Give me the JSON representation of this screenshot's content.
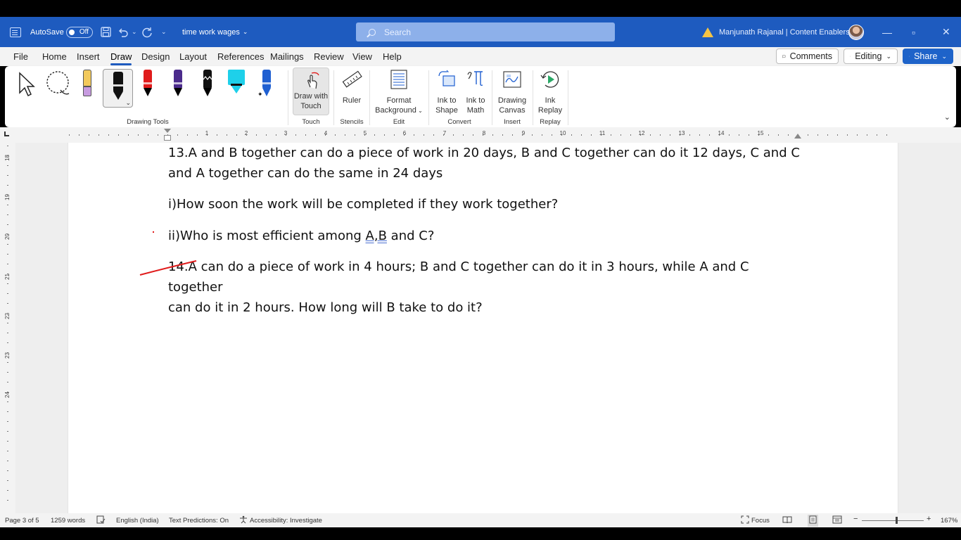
{
  "titlebar": {
    "autosave_label": "AutoSave",
    "autosave_state": "Off",
    "doc_title": "time work wages",
    "search_placeholder": "Search",
    "user_name": "Manjunath Rajanal | Content Enablers"
  },
  "menu": {
    "tabs": [
      "File",
      "Home",
      "Insert",
      "Draw",
      "Design",
      "Layout",
      "References",
      "Mailings",
      "Review",
      "View",
      "Help"
    ],
    "active_tab": "Draw",
    "comments_label": "Comments",
    "editing_label": "Editing",
    "share_label": "Share"
  },
  "ribbon": {
    "groups": {
      "drawing_tools": "Drawing Tools",
      "touch": "Touch",
      "stencils": "Stencils",
      "edit": "Edit",
      "convert": "Convert",
      "insert": "Insert",
      "replay": "Replay"
    },
    "buttons": {
      "draw_with_touch_1": "Draw with",
      "draw_with_touch_2": "Touch",
      "ruler": "Ruler",
      "format_bg_1": "Format",
      "format_bg_2": "Background",
      "ink_shape_1": "Ink to",
      "ink_shape_2": "Shape",
      "ink_math_1": "Ink to",
      "ink_math_2": "Math",
      "drawing_canvas_1": "Drawing",
      "drawing_canvas_2": "Canvas",
      "ink_replay_1": "Ink",
      "ink_replay_2": "Replay"
    },
    "pen_colors": [
      "#f2c95c",
      "#111111",
      "#e01b1b",
      "#4b2b8c",
      "#111111",
      "#1ed0ea",
      "#1f5fd1"
    ]
  },
  "ruler": {
    "h_numbers": [
      "1",
      "2",
      "3",
      "4",
      "5",
      "6",
      "7",
      "8",
      "9",
      "10",
      "11",
      "12",
      "13",
      "14",
      "15"
    ],
    "v_numbers": [
      "18",
      "19",
      "20",
      "21",
      "22",
      "23",
      "24"
    ]
  },
  "document": {
    "p13_line1": "13.A and B together can do a piece of work in 20 days, B and C together can do it 12 days, C and C",
    "p13_line2": "and A together can do the same in 24 days",
    "q_i": "i)How soon the work will be completed if they work together?",
    "q_ii_prefix": "ii)Who is most efficient among ",
    "q_ii_underlined": "A,B",
    "q_ii_suffix": " and C?",
    "p14_line1": "14.A can do a piece of work in 4 hours; B and C together can do it in 3 hours, while A and C together",
    "p14_line2": "can do it in 2 hours. How long will B take to do it?"
  },
  "status": {
    "page": "Page 3 of 5",
    "words": "1259 words",
    "language": "English (India)",
    "predictions": "Text Predictions: On",
    "accessibility": "Accessibility: Investigate",
    "focus": "Focus",
    "zoom": "167%"
  },
  "colors": {
    "titlebar": "#1e5bbf",
    "accent": "#1e63c9",
    "ink_red": "#e01b1b"
  }
}
